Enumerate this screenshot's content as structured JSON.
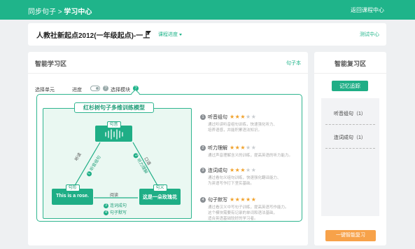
{
  "topbar": {
    "crumb_prefix": "同步句子 > ",
    "crumb_current": "学习中心",
    "back_link": "返回课程中心"
  },
  "course": {
    "title": "人教社新起点2012(一年级起点)-一上",
    "progress_link": "课程进度",
    "test_link": "测试中心"
  },
  "learn": {
    "header": "智能学习区",
    "book_link": "句子本",
    "filters": {
      "unit_label": "选择单元",
      "progress_label": "进度",
      "module_label": "选择模块"
    },
    "model": {
      "title": "红杉树句子多维训练模型",
      "top_node": {
        "tag": "句音"
      },
      "left_node": {
        "tag": "句形",
        "text": "This is a rose."
      },
      "right_node": {
        "tag": "句义",
        "text": "这是一朵玫瑰花"
      },
      "edge_left_plain": "听读",
      "edge_left_green": "听音组句",
      "edge_left_num": "1",
      "edge_right_plain": "口语",
      "edge_right_green": "听力理解",
      "edge_right_num": "2",
      "edge_bottom_plain": "阅读",
      "edge_bottom_items": [
        {
          "num": "3",
          "label": "连词成句"
        },
        {
          "num": "4",
          "label": "句子默写"
        }
      ]
    },
    "skills": [
      {
        "num": "1",
        "label": "听音组句",
        "rating": 3,
        "max": 5,
        "desc": [
          "通过听读听音组句训练，快速强化听力、",
          "培养语感，并能积累语法知识。"
        ]
      },
      {
        "num": "2",
        "label": "听力理解",
        "rating": 3,
        "max": 5,
        "desc": [
          "通过声音理解含义的训练，提高英语的听力能力。"
        ]
      },
      {
        "num": "3",
        "label": "连词成句",
        "rating": 3,
        "max": 5,
        "desc": [
          "通过看句义组句训练，快速强化翻译能力、",
          "为英语写作打下坚实基础。"
        ]
      },
      {
        "num": "4",
        "label": "句子默写",
        "rating": 5,
        "max": 5,
        "desc": [
          "通过看汉义中写句子训练，提高英语写作能力。",
          "这个模块需要有记录的单词和语法基础，",
          "适合英语基础较好的学习者。"
        ]
      }
    ]
  },
  "review": {
    "header": "智能复习区",
    "memory_button": "记忆追踪",
    "items": [
      {
        "label": "听音组句（1）"
      },
      {
        "label": "连词成句（1）"
      }
    ],
    "onekey_button": "一键智能复习"
  },
  "colors": {
    "brand": "#1fb48a",
    "star": "#f0a12a",
    "orange": "#f7a24a"
  }
}
